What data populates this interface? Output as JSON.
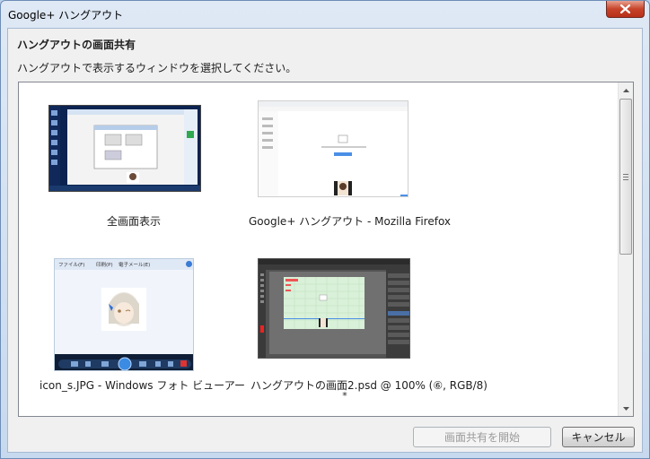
{
  "window": {
    "title": "Google+ ハングアウト"
  },
  "dialog": {
    "heading": "ハングアウトの画面共有",
    "instruction": "ハングアウトで表示するウィンドウを選択してください。"
  },
  "windows_list": [
    {
      "label": "全画面表示"
    },
    {
      "label": "Google+ ハングアウト - Mozilla Firefox"
    },
    {
      "label": "icon_s.JPG - Windows フォト ビューアー"
    },
    {
      "label": "ハングアウトの画面2.psd @ 100% (⑥, RGB/8)",
      "label2": "*"
    }
  ],
  "photo_viewer_menu": {
    "file": "ファイル(F)",
    "print": "印刷(P)",
    "email": "電子メール(E)"
  },
  "buttons": {
    "start_share": "画面共有を開始",
    "cancel": "キャンセル"
  },
  "icons": {
    "close": "close-icon",
    "scroll_up": "chevron-up-icon",
    "scroll_down": "chevron-down-icon"
  },
  "colors": {
    "close_button": "#c7442a",
    "title_bar": "#dfe9f5",
    "client_bg": "#f0f0f0"
  }
}
